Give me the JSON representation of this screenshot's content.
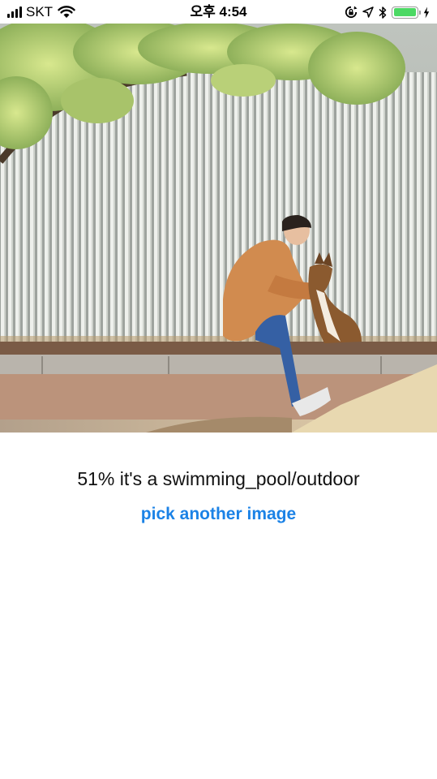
{
  "status_bar": {
    "carrier": "SKT",
    "time": "오후 4:54",
    "battery_level": 1.0,
    "signal_bars": 4,
    "icons": [
      "signal-icon",
      "wifi-icon",
      "rotation-lock-icon",
      "location-icon",
      "bluetooth-icon",
      "battery-icon",
      "charging-icon"
    ]
  },
  "photo": {
    "icon": "photo-image"
  },
  "result": {
    "text": "51% it's a swimming_pool/outdoor"
  },
  "actions": {
    "pick_label": "pick another image"
  },
  "colors": {
    "link": "#1b82e6",
    "battery": "#4cd964",
    "text": "#111111"
  }
}
